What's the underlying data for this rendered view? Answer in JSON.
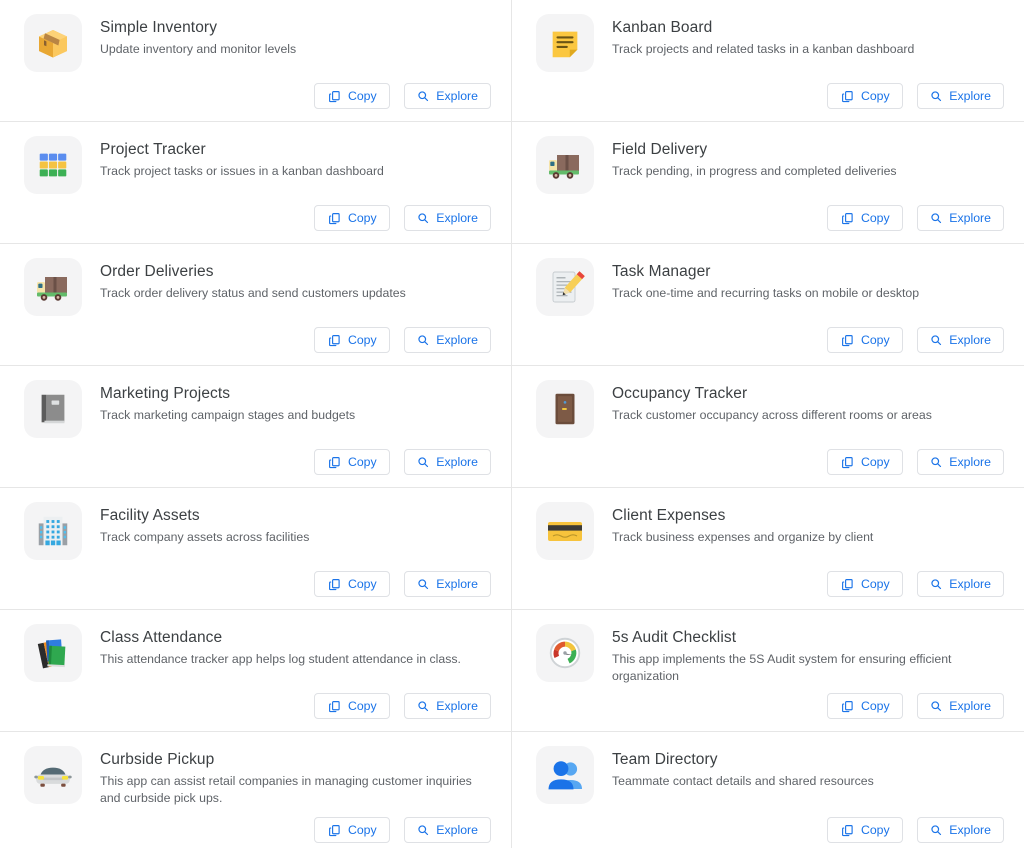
{
  "buttons": {
    "copy_label": "Copy",
    "explore_label": "Explore"
  },
  "colors": {
    "link_blue": "#1a73e8",
    "title_gray": "#3c4043",
    "desc_gray": "#5f6368",
    "divider": "#e6e6e6",
    "icon_tile_bg": "#f4f4f5"
  },
  "apps": [
    {
      "title": "Simple Inventory",
      "description": "Update inventory and monitor levels",
      "icon": "package-box-icon"
    },
    {
      "title": "Kanban Board",
      "description": "Track projects and related tasks in a kanban dashboard",
      "icon": "sticky-note-icon"
    },
    {
      "title": "Project Tracker",
      "description": "Track project tasks or issues in a kanban dashboard",
      "icon": "grid-tiles-icon"
    },
    {
      "title": "Field Delivery",
      "description": "Track pending, in progress and completed deliveries",
      "icon": "delivery-truck-icon"
    },
    {
      "title": "Order Deliveries",
      "description": "Track order delivery status and send customers updates",
      "icon": "delivery-truck-icon"
    },
    {
      "title": "Task Manager",
      "description": "Track one-time and recurring tasks on mobile or desktop",
      "icon": "memo-pencil-icon"
    },
    {
      "title": "Marketing Projects",
      "description": "Track marketing campaign stages and budgets",
      "icon": "closed-book-icon"
    },
    {
      "title": "Occupancy Tracker",
      "description": "Track customer occupancy across different rooms or areas",
      "icon": "door-icon"
    },
    {
      "title": "Facility Assets",
      "description": "Track company assets across facilities",
      "icon": "office-building-icon"
    },
    {
      "title": "Client Expenses",
      "description": "Track business expenses and organize by client",
      "icon": "credit-card-icon"
    },
    {
      "title": "Class Attendance",
      "description": "This attendance tracker app helps log student attendance in class.",
      "icon": "stack-of-books-icon"
    },
    {
      "title": "5s Audit Checklist",
      "description": "This app implements the 5S Audit system for ensuring efficient organization",
      "icon": "gauge-meter-icon"
    },
    {
      "title": "Curbside Pickup",
      "description": "This app can assist retail companies in managing customer inquiries and curbside pick ups.",
      "icon": "car-front-icon"
    },
    {
      "title": "Team Directory",
      "description": "Teammate contact details and shared resources",
      "icon": "two-people-icon"
    }
  ]
}
